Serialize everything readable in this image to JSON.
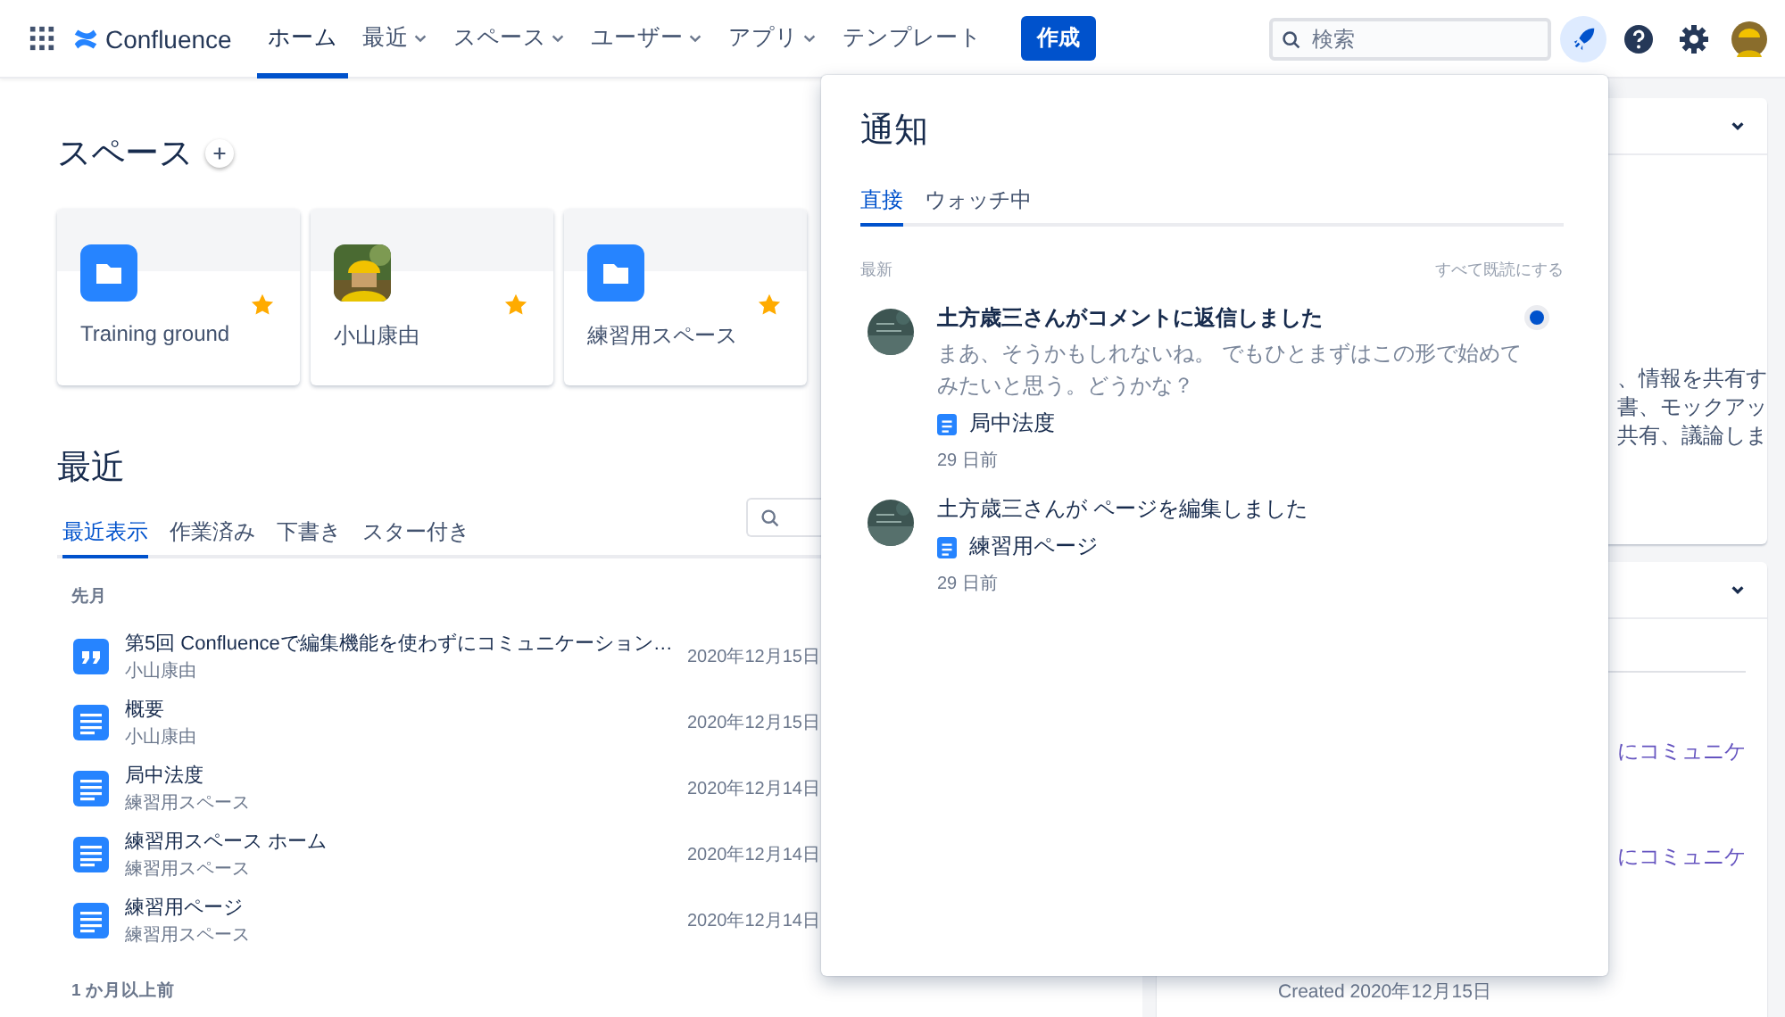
{
  "nav": {
    "app_name": "Confluence",
    "items": [
      {
        "label": "ホーム",
        "selected": true,
        "dropdown": false
      },
      {
        "label": "最近",
        "selected": false,
        "dropdown": true
      },
      {
        "label": "スペース",
        "selected": false,
        "dropdown": true
      },
      {
        "label": "ユーザー",
        "selected": false,
        "dropdown": true
      },
      {
        "label": "アプリ",
        "selected": false,
        "dropdown": true
      },
      {
        "label": "テンプレート",
        "selected": false,
        "dropdown": false
      }
    ],
    "create_button": "作成",
    "search": {
      "placeholder": "検索"
    },
    "notifications_open": true
  },
  "spaces": {
    "title": "スペース",
    "cards": [
      {
        "name": "Training ground",
        "kind": "folder",
        "starred": true
      },
      {
        "name": "小山康由",
        "kind": "picture",
        "starred": true
      },
      {
        "name": "練習用スペース",
        "kind": "folder",
        "starred": true
      }
    ]
  },
  "recent": {
    "title": "最近",
    "tabs": [
      {
        "label": "最近表示",
        "selected": true
      },
      {
        "label": "作業済み",
        "selected": false
      },
      {
        "label": "下書き",
        "selected": false
      },
      {
        "label": "スター付き",
        "selected": false
      }
    ],
    "groups": [
      {
        "label": "先月",
        "items": [
          {
            "kind": "blog",
            "title": "第5回 Confluenceで編集機能を使わずにコミュニケーション…",
            "space": "小山康由",
            "date": "2020年12月15日"
          },
          {
            "kind": "page",
            "title": "概要",
            "space": "小山康由",
            "date": "2020年12月15日"
          },
          {
            "kind": "page",
            "title": "局中法度",
            "space": "練習用スペース",
            "date": "2020年12月14日"
          },
          {
            "kind": "page",
            "title": "練習用スペース ホーム",
            "space": "練習用スペース",
            "date": "2020年12月14日"
          },
          {
            "kind": "page",
            "title": "練習用ページ",
            "space": "練習用スペース",
            "date": "2020年12月14日"
          }
        ]
      },
      {
        "label": "1 か月以上前"
      }
    ]
  },
  "right_panels": [
    {
      "lines": [
        "、情報を共有す",
        "書、モックアッ",
        "共有、議論しま"
      ]
    },
    {
      "links": [
        "にコミュニケ",
        "にコミュニケ"
      ],
      "created": "Created 2020年12月15日"
    }
  ],
  "notifications": {
    "title": "通知",
    "tabs": [
      {
        "label": "直接",
        "selected": true
      },
      {
        "label": "ウォッチ中",
        "selected": false
      }
    ],
    "section_label": "最新",
    "mark_all_read": "すべて既読にする",
    "items": [
      {
        "title": "土方歳三さんがコメントに返信しました",
        "unread": true,
        "excerpt": "まあ、そうかもしれないね。 でもひとまずはこの形で始めてみたいと思う。どうかな？",
        "page": "局中法度",
        "time": "29 日前"
      },
      {
        "title": "土方歳三さんが ページを編集しました",
        "unread": false,
        "page": "練習用ページ",
        "time": "29 日前"
      }
    ]
  }
}
